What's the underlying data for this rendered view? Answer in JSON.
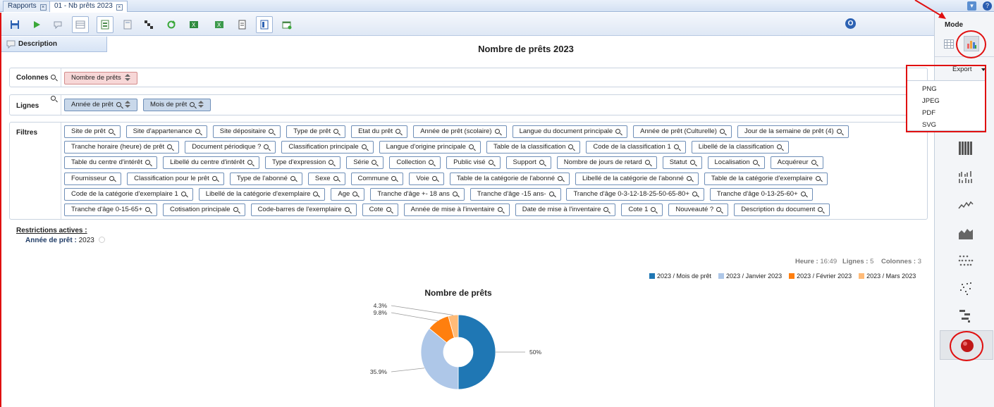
{
  "tabs": [
    {
      "label": "Rapports"
    },
    {
      "label": "01 - Nb prêts 2023"
    }
  ],
  "description_label": "Description",
  "report_title": "Nombre de prêts 2023",
  "colonnes": {
    "label": "Colonnes",
    "chips": [
      "Nombre de prêts"
    ]
  },
  "lignes": {
    "label": "Lignes",
    "chips": [
      "Année de prêt",
      "Mois de prêt"
    ]
  },
  "filtres": {
    "label": "Filtres",
    "rows": [
      [
        "Site de prêt",
        "Site d'appartenance",
        "Site dépositaire",
        "Type de prêt",
        "Etat du prêt",
        "Année de prêt (scolaire)",
        "Langue du document principale",
        "Année de prêt (Culturelle)",
        "Jour de la semaine de prêt (4)"
      ],
      [
        "Tranche horaire (heure) de prêt",
        "Document périodique ?",
        "Classification principale",
        "Langue d'origine principale",
        "Table de la classification",
        "Code de la classification 1",
        "Libellé de la classification"
      ],
      [
        "Table du centre d'intérêt",
        "Libellé du centre d'intérêt",
        "Type d'expression",
        "Série",
        "Collection",
        "Public visé",
        "Support",
        "Nombre de jours de retard",
        "Statut",
        "Localisation",
        "Acquéreur"
      ],
      [
        "Fournisseur",
        "Classification pour le prêt",
        "Type de l'abonné",
        "Sexe",
        "Commune",
        "Voie",
        "Table de la catégorie de l'abonné",
        "Libellé de la catégorie de l'abonné",
        "Table de la catégorie d'exemplaire"
      ],
      [
        "Code de la catégorie d'exemplaire 1",
        "Libellé de la catégorie d'exemplaire",
        "Age",
        "Tranche d'âge +- 18 ans",
        "Tranche d'âge -15 ans-",
        "Tranche d'âge 0-3-12-18-25-50-65-80+",
        "Tranche d'âge 0-13-25-60+"
      ],
      [
        "Tranche d'âge 0-15-65+",
        "Cotisation principale",
        "Code-barres de l'exemplaire",
        "Cote",
        "Année de mise à l'inventaire",
        "Date de mise à l'inventaire",
        "Cote 1",
        "Nouveauté ?",
        "Description du document"
      ]
    ]
  },
  "restrictions": {
    "title": "Restrictions actives :",
    "key": "Année de prêt",
    "value": "2023"
  },
  "status": {
    "heure_label": "Heure :",
    "heure": "16:49",
    "lignes_label": "Lignes :",
    "lignes": "5",
    "colonnes_label": "Colonnes :",
    "colonnes": "3"
  },
  "side": {
    "mode_label": "Mode",
    "export_label": "Export",
    "export_options": [
      "PNG",
      "JPEG",
      "PDF",
      "SVG"
    ]
  },
  "colors": {
    "accent_red": "#e01010",
    "series1": "#1f77b4",
    "series2": "#aec7e8",
    "series3": "#ff7f0e",
    "series4": "#ffbb78"
  },
  "chart_data": {
    "type": "pie",
    "title": "Nombre de prêts",
    "legend": [
      "2023 / Mois de prêt",
      "2023 / Janvier 2023",
      "2023 / Février 2023",
      "2023 / Mars 2023"
    ],
    "slices": [
      {
        "label": "50%",
        "value": 50,
        "color": "#1f77b4"
      },
      {
        "label": "35.9%",
        "value": 35.9,
        "color": "#aec7e8"
      },
      {
        "label": "9.8%",
        "value": 9.8,
        "color": "#ff7f0e"
      },
      {
        "label": "4.3%",
        "value": 4.3,
        "color": "#ffbb78"
      }
    ]
  }
}
